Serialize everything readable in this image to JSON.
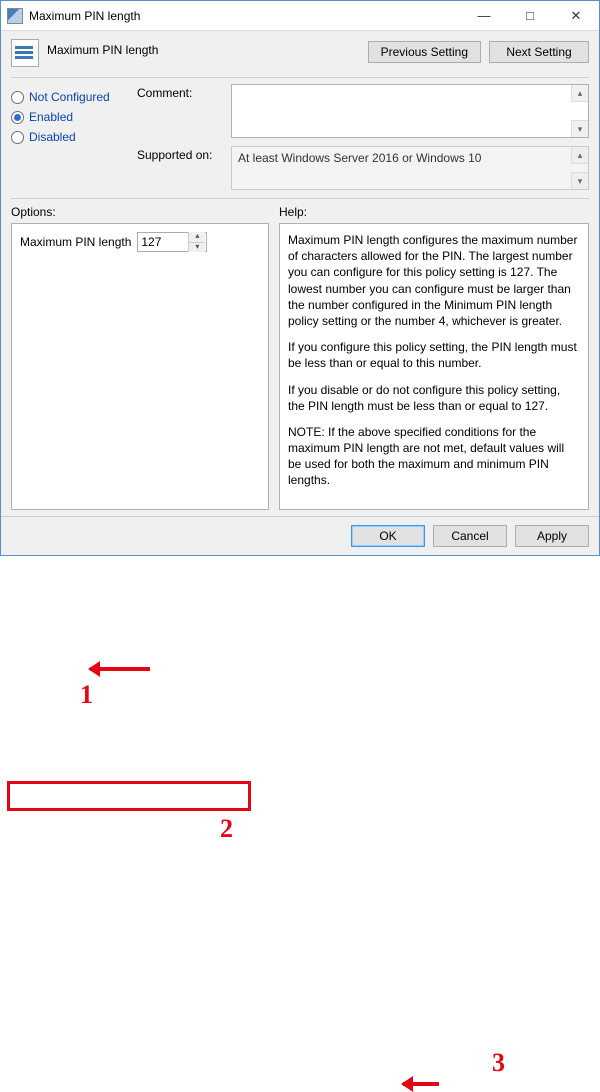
{
  "window": {
    "title": "Maximum PIN length"
  },
  "header": {
    "policy_name": "Maximum PIN length",
    "prev_btn": "Previous Setting",
    "next_btn": "Next Setting"
  },
  "config": {
    "radios": {
      "not_configured": "Not Configured",
      "enabled": "Enabled",
      "disabled": "Disabled",
      "selected": "enabled"
    },
    "comment_label": "Comment:",
    "comment_value": "",
    "supported_label": "Supported on:",
    "supported_value": "At least Windows Server 2016 or Windows 10"
  },
  "options": {
    "pane_label": "Options:",
    "item_label": "Maximum PIN length",
    "item_value": "127"
  },
  "help": {
    "pane_label": "Help:",
    "p1": "Maximum PIN length configures the maximum number of characters allowed for the PIN.  The largest number you can configure for this policy setting is 127. The lowest number you can configure must be larger than the number configured in the Minimum PIN length policy setting or the number 4, whichever is greater.",
    "p2": "If you configure this policy setting, the PIN length must be less than or equal to this number.",
    "p3": "If you disable or do not configure this policy setting, the PIN length must be less than or equal to 127.",
    "p4": "NOTE: If the above specified conditions for the maximum PIN length are not met, default values will be used for both the maximum and minimum PIN lengths."
  },
  "footer": {
    "ok": "OK",
    "cancel": "Cancel",
    "apply": "Apply"
  },
  "annotations": {
    "n1": "1",
    "n2": "2",
    "n3": "3"
  }
}
